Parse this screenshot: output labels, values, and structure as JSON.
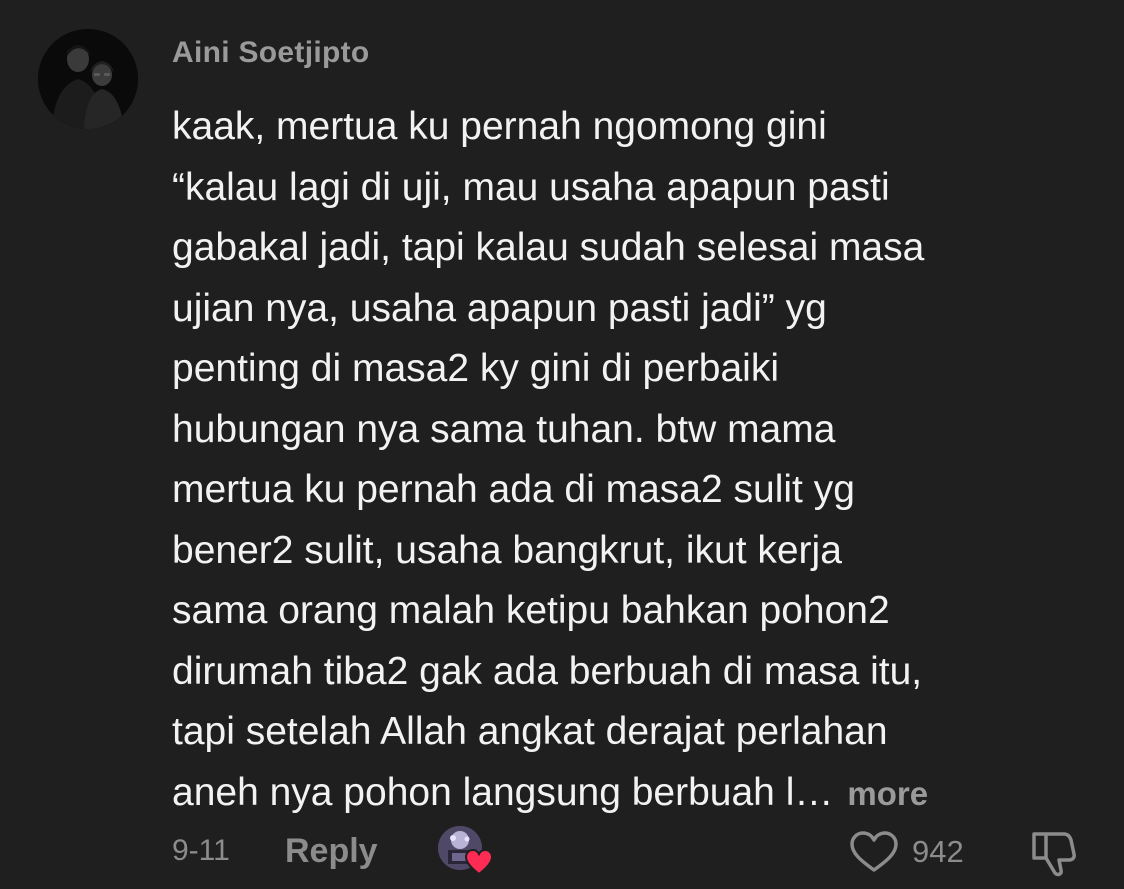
{
  "comment": {
    "username": "Aini Soetjipto",
    "lines": [
      "kaak, mertua ku pernah ngomong gini",
      "“kalau lagi di uji, mau usaha apapun pasti",
      "gabakal jadi, tapi kalau sudah selesai masa",
      "ujian nya, usaha apapun pasti jadi” yg",
      "penting di masa2 ky gini di perbaiki",
      "hubungan nya sama tuhan. btw mama",
      "mertua ku pernah ada di masa2 sulit yg",
      "bener2 sulit, usaha bangkrut, ikut kerja",
      "sama orang malah ketipu bahkan pohon2",
      "dirumah tiba2 gak ada berbuah di masa itu,",
      "tapi setelah Allah angkat derajat perlahan",
      "aneh nya pohon langsung berbuah l…"
    ],
    "more_label": "more",
    "date": "9-11",
    "reply_label": "Reply",
    "like_count": "942"
  },
  "icons": {
    "avatar": "profile-photo",
    "liker": "creator-liked-avatar-with-heart",
    "like": "heart-outline-icon",
    "dislike": "thumbs-down-outline-icon"
  },
  "colors": {
    "background": "#1f1f1f",
    "text": "#f2f2f2",
    "muted": "#8c8c8c",
    "heart_badge": "#fe2c55"
  }
}
